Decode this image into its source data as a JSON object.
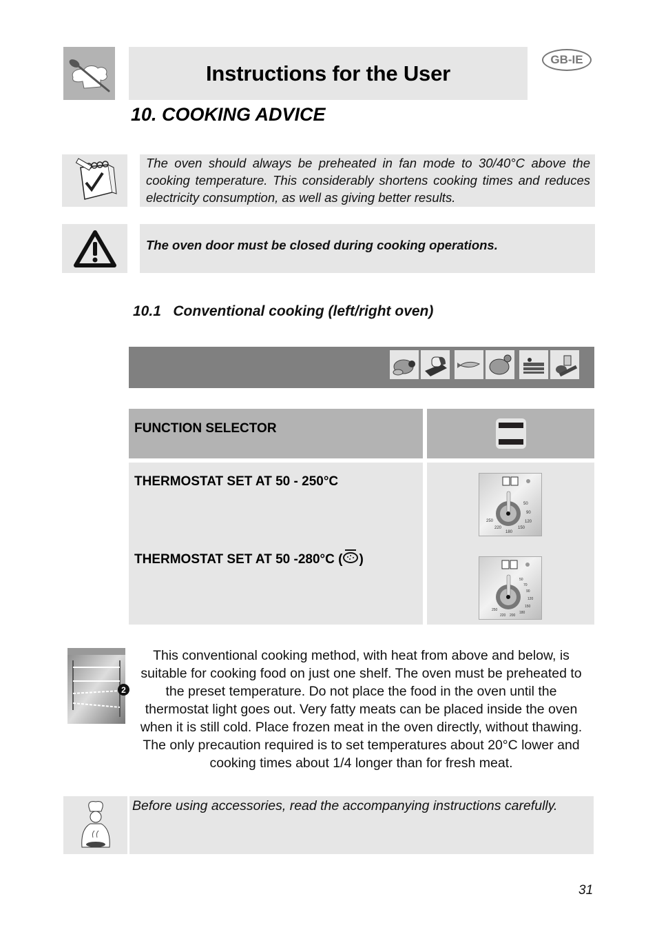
{
  "header": {
    "title": "Instructions for the User",
    "language_badge": "GB-IE",
    "logo_icon": "spoon-chef-hat-icon"
  },
  "section": {
    "title": "10. COOKING ADVICE"
  },
  "notes": {
    "tip": {
      "icon": "notepad-check-icon",
      "text": "The oven should always be preheated in fan mode to 30/40°C above the cooking temperature. This considerably shortens cooking times and reduces electricity consumption, as well as giving better results."
    },
    "warning": {
      "icon": "warning-triangle-icon",
      "text": "The oven door must be closed during cooking operations."
    }
  },
  "subsection": {
    "title": "10.1   Conventional cooking (left/right oven)"
  },
  "food_icons": [
    "meat-roast-icon",
    "bread-icon",
    "fish-icon",
    "poultry-icon",
    "cake-icon",
    "vegetables-icon"
  ],
  "table": {
    "function_selector": {
      "label": "FUNCTION SELECTOR",
      "icon": "top-bottom-heat-icon"
    },
    "thermostat_1": {
      "label": "THERMOSTAT SET AT 50 - 250°C",
      "dial_labels": [
        "50",
        "90",
        "120",
        "150",
        "180",
        "220",
        "250"
      ]
    },
    "thermostat_2": {
      "label_prefix": "THERMOSTAT SET AT 50 -280°C (",
      "label_suffix": ")",
      "inline_icon": "grill-icon",
      "dial_labels": [
        "50",
        "70",
        "90",
        "120",
        "150",
        "180",
        "200",
        "220",
        "250"
      ]
    }
  },
  "description": {
    "shelf_number": "2",
    "oven_icon": "oven-shelves-icon",
    "text": "This conventional cooking method, with heat from above and below, is suitable for cooking food on just one shelf. The oven must be preheated to the preset temperature. Do not place the food in the oven until the thermostat light goes out. Very fatty meats can be placed inside the oven when it is still cold. Place frozen meat in the oven directly, without thawing. The only precaution required is to set temperatures about 20°C lower and cooking times about 1/4 longer than for fresh meat."
  },
  "accessory_note": {
    "icon": "chef-icon",
    "text": "Before using accessories, read the accompanying instructions carefully."
  },
  "page_number": "31"
}
